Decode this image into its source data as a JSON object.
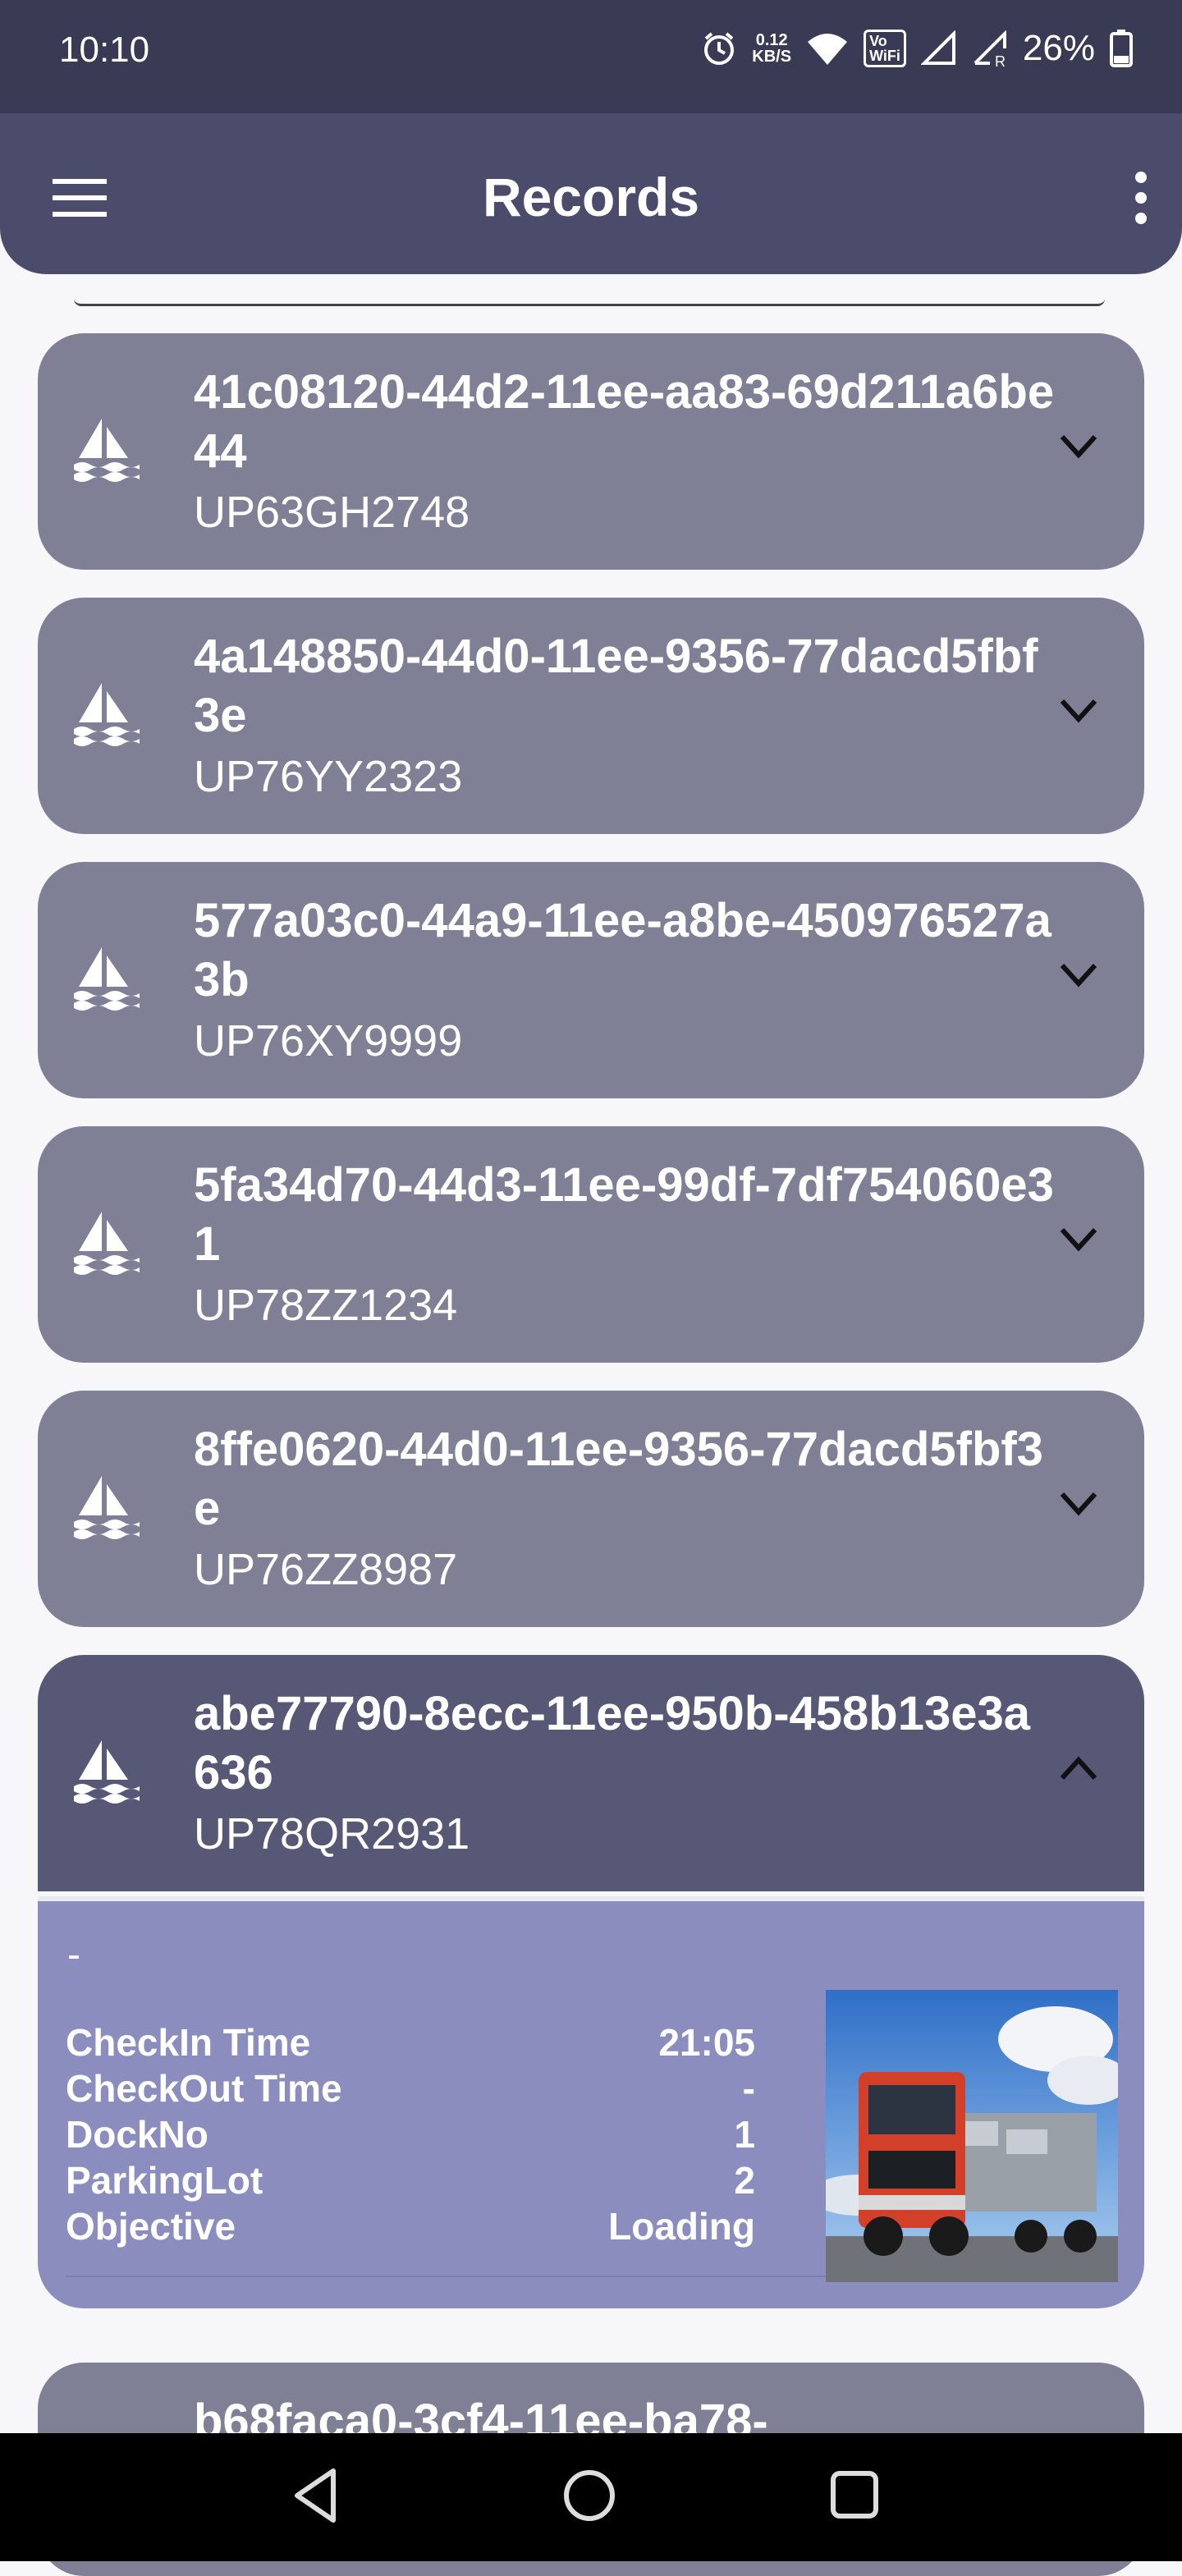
{
  "status_bar": {
    "time": "10:10",
    "net_speed_value": "0.12",
    "net_speed_unit": "KB/S",
    "vowifi_top": "Vo",
    "vowifi_bottom": "WiFi",
    "battery": "26%"
  },
  "app_bar": {
    "title": "Records"
  },
  "records": [
    {
      "id": "41c08120-44d2-11ee-aa83-69d211a6be44",
      "plate": "UP63GH2748",
      "expanded": false
    },
    {
      "id": "4a148850-44d0-11ee-9356-77dacd5fbf3e",
      "plate": "UP76YY2323",
      "expanded": false
    },
    {
      "id": "577a03c0-44a9-11ee-a8be-450976527a3b",
      "plate": "UP76XY9999",
      "expanded": false
    },
    {
      "id": "5fa34d70-44d3-11ee-99df-7df754060e31",
      "plate": "UP78ZZ1234",
      "expanded": false
    },
    {
      "id": "8ffe0620-44d0-11ee-9356-77dacd5fbf3e",
      "plate": "UP76ZZ8987",
      "expanded": false
    },
    {
      "id": "abe77790-8ecc-11ee-950b-458b13e3a636",
      "plate": "UP78QR2931",
      "expanded": true
    },
    {
      "id": "b68faca0-3cf4-11ee-ba78-",
      "plate": "",
      "expanded": false
    }
  ],
  "detail": {
    "dash": "-",
    "rows": [
      {
        "label": "CheckIn Time",
        "value": "21:05"
      },
      {
        "label": "CheckOut Time",
        "value": "-"
      },
      {
        "label": "DockNo",
        "value": "1"
      },
      {
        "label": "ParkingLot",
        "value": "2"
      },
      {
        "label": "Objective",
        "value": "Loading"
      }
    ],
    "image": "truck-photo"
  },
  "icons": {
    "record": "sailboat-icon",
    "collapsed": "chevron-down-icon",
    "expanded": "chevron-up-icon"
  }
}
